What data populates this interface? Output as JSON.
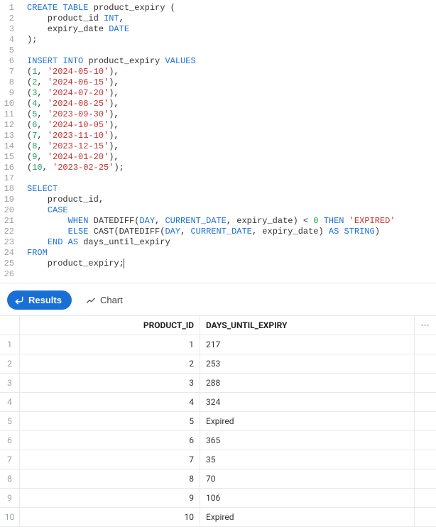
{
  "editor": {
    "lines": [
      {
        "n": 1,
        "html": "<span class='kw'>CREATE</span> <span class='kw'>TABLE</span> product_expiry ("
      },
      {
        "n": 2,
        "html": "    product_id <span class='tk-type'>INT</span>,"
      },
      {
        "n": 3,
        "html": "    expiry_date <span class='tk-type'>DATE</span>"
      },
      {
        "n": 4,
        "html": ");"
      },
      {
        "n": 5,
        "html": ""
      },
      {
        "n": 6,
        "html": "<span class='kw'>INSERT</span> <span class='kw'>INTO</span> product_expiry <span class='kw'>VALUES</span>"
      },
      {
        "n": 7,
        "html": "(<span class='num'>1</span>, <span class='str'>'2024-05-10'</span>),"
      },
      {
        "n": 8,
        "html": "(<span class='num'>2</span>, <span class='str'>'2024-06-15'</span>),"
      },
      {
        "n": 9,
        "html": "(<span class='num'>3</span>, <span class='str'>'2024-07-20'</span>),"
      },
      {
        "n": 10,
        "html": "(<span class='num'>4</span>, <span class='str'>'2024-08-25'</span>),"
      },
      {
        "n": 11,
        "html": "(<span class='num'>5</span>, <span class='str'>'2023-09-30'</span>),"
      },
      {
        "n": 12,
        "html": "(<span class='num'>6</span>, <span class='str'>'2024-10-05'</span>),"
      },
      {
        "n": 13,
        "html": "(<span class='num'>7</span>, <span class='str'>'2023-11-10'</span>),"
      },
      {
        "n": 14,
        "html": "(<span class='num'>8</span>, <span class='str'>'2023-12-15'</span>),"
      },
      {
        "n": 15,
        "html": "(<span class='num'>9</span>, <span class='str'>'2024-01-20'</span>),"
      },
      {
        "n": 16,
        "html": "(<span class='num'>10</span>, <span class='str'>'2023-02-25'</span>);"
      },
      {
        "n": 17,
        "html": ""
      },
      {
        "n": 18,
        "html": "<span class='kw'>SELECT</span>"
      },
      {
        "n": 19,
        "html": "    product_id,"
      },
      {
        "n": 20,
        "html": "    <span class='kw'>CASE</span>"
      },
      {
        "n": 21,
        "html": "        <span class='kw'>WHEN</span> <span class='func'>DATEDIFF</span>(<span class='kw'>DAY</span>, <span class='kw'>CURRENT_DATE</span>, expiry_date) &lt; <span class='num'>0</span> <span class='kw'>THEN</span> <span class='str'>'EXPIRED'</span>"
      },
      {
        "n": 22,
        "html": "        <span class='kw'>ELSE</span> <span class='func'>CAST</span>(<span class='func'>DATEDIFF</span>(<span class='kw'>DAY</span>, <span class='kw'>CURRENT_DATE</span>, expiry_date) <span class='kw'>AS</span> <span class='kw'>STRING</span>)"
      },
      {
        "n": 23,
        "html": "    <span class='kw'>END</span> <span class='kw'>AS</span> days_until_expiry"
      },
      {
        "n": 24,
        "html": "<span class='kw'>FROM</span>"
      },
      {
        "n": 25,
        "html": "    product_expiry;<span class='cursor-bar'></span>"
      },
      {
        "n": 26,
        "html": ""
      }
    ]
  },
  "tabs": {
    "results": "Results",
    "chart": "Chart"
  },
  "grid": {
    "columns": [
      "PRODUCT_ID",
      "DAYS_UNTIL_EXPIRY"
    ],
    "more": "···",
    "rows": [
      {
        "row": 1,
        "product_id": 1,
        "days_until_expiry": "217"
      },
      {
        "row": 2,
        "product_id": 2,
        "days_until_expiry": "253"
      },
      {
        "row": 3,
        "product_id": 3,
        "days_until_expiry": "288"
      },
      {
        "row": 4,
        "product_id": 4,
        "days_until_expiry": "324"
      },
      {
        "row": 5,
        "product_id": 5,
        "days_until_expiry": "Expired"
      },
      {
        "row": 6,
        "product_id": 6,
        "days_until_expiry": "365"
      },
      {
        "row": 7,
        "product_id": 7,
        "days_until_expiry": "35"
      },
      {
        "row": 8,
        "product_id": 8,
        "days_until_expiry": "70"
      },
      {
        "row": 9,
        "product_id": 9,
        "days_until_expiry": "106"
      },
      {
        "row": 10,
        "product_id": 10,
        "days_until_expiry": "Expired"
      }
    ]
  }
}
